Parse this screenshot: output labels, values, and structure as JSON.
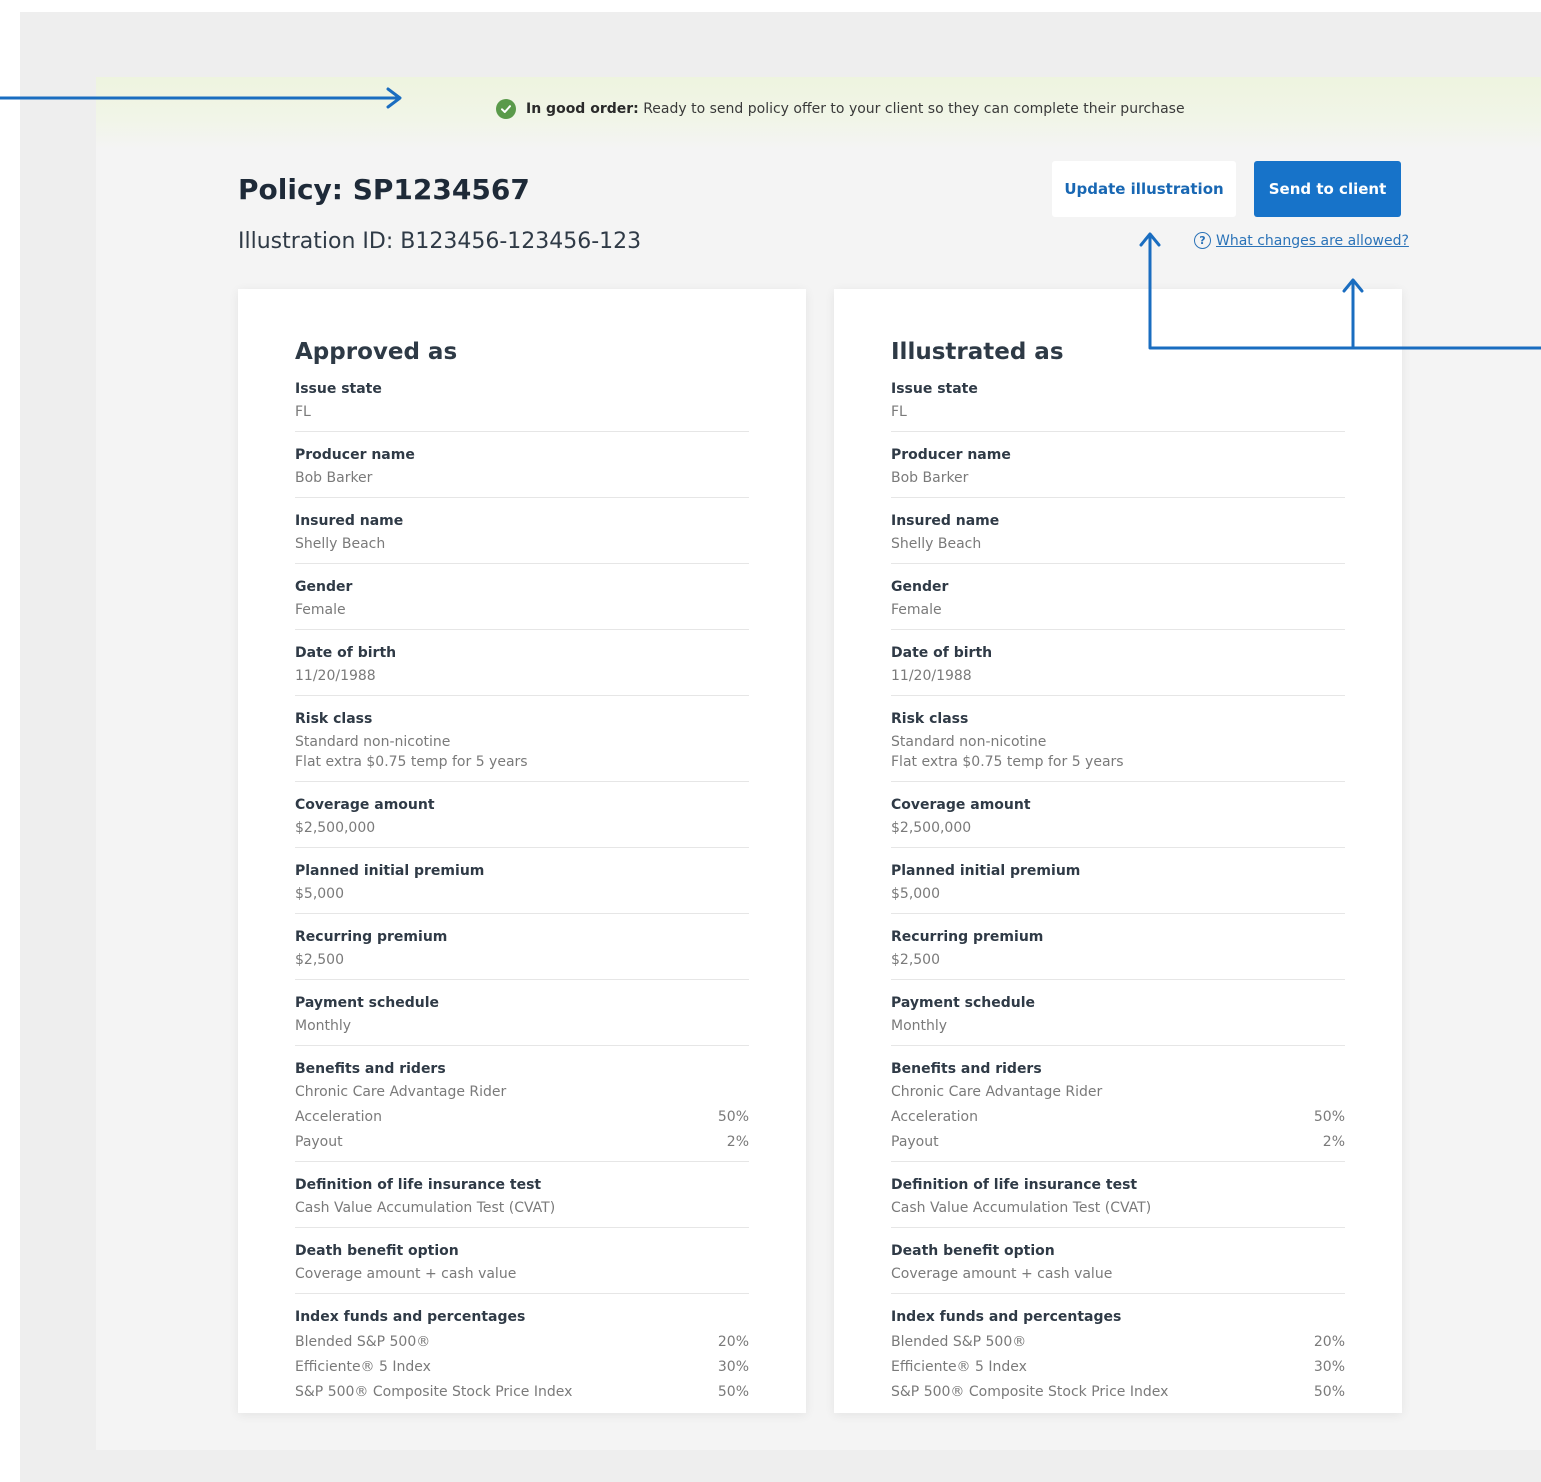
{
  "banner": {
    "status_label": "In good order:",
    "message": "Ready to send policy offer to your client so they can complete their purchase"
  },
  "header": {
    "policy_title": "Policy: SP1234567",
    "illustration_id": "Illustration ID: B123456-123456-123",
    "update_button": "Update illustration",
    "send_button": "Send to client",
    "help_link": "What changes are allowed?"
  },
  "colors": {
    "primary": "#1773c9",
    "success": "#5a9a4a",
    "annotation": "#1a6dc0"
  },
  "icons": [
    "check-circle-icon",
    "question-circle-icon",
    "annotation-arrow"
  ],
  "cards": {
    "approved": {
      "title": "Approved as",
      "issue_state": {
        "label": "Issue state",
        "value": "FL"
      },
      "producer_name": {
        "label": "Producer name",
        "value": "Bob Barker"
      },
      "insured_name": {
        "label": "Insured name",
        "value": "Shelly Beach"
      },
      "gender": {
        "label": "Gender",
        "value": "Female"
      },
      "date_of_birth": {
        "label": "Date of birth",
        "value": "11/20/1988"
      },
      "risk_class": {
        "label": "Risk class",
        "value": "Standard non-nicotine",
        "value2": "Flat extra $0.75 temp for 5 years"
      },
      "coverage_amount": {
        "label": "Coverage amount",
        "value": "$2,500,000"
      },
      "planned_initial_premium": {
        "label": "Planned initial premium",
        "value": "$5,000"
      },
      "recurring_premium": {
        "label": "Recurring premium",
        "value": "$2,500"
      },
      "payment_schedule": {
        "label": "Payment schedule",
        "value": "Monthly"
      },
      "benefits": {
        "label": "Benefits and riders",
        "rider": "Chronic Care Advantage Rider",
        "acceleration_label": "Acceleration",
        "acceleration_value": "50%",
        "payout_label": "Payout",
        "payout_value": "2%"
      },
      "life_test": {
        "label": "Definition of life insurance test",
        "value": "Cash Value Accumulation Test (CVAT)"
      },
      "death_benefit": {
        "label": "Death benefit option",
        "value": "Coverage amount + cash value"
      },
      "index_funds": {
        "label": "Index funds and percentages",
        "f1_name": "Blended S&P 500®",
        "f1_pct": "20%",
        "f2_name": "Efficiente® 5 Index",
        "f2_pct": "30%",
        "f3_name": "S&P 500® Composite Stock Price Index",
        "f3_pct": "50%"
      }
    },
    "illustrated": {
      "title": "Illustrated as",
      "issue_state": {
        "label": "Issue state",
        "value": "FL"
      },
      "producer_name": {
        "label": "Producer name",
        "value": "Bob Barker"
      },
      "insured_name": {
        "label": "Insured name",
        "value": "Shelly Beach"
      },
      "gender": {
        "label": "Gender",
        "value": "Female"
      },
      "date_of_birth": {
        "label": "Date of birth",
        "value": "11/20/1988"
      },
      "risk_class": {
        "label": "Risk class",
        "value": "Standard non-nicotine",
        "value2": "Flat extra $0.75 temp for 5 years"
      },
      "coverage_amount": {
        "label": "Coverage amount",
        "value": "$2,500,000"
      },
      "planned_initial_premium": {
        "label": "Planned initial premium",
        "value": "$5,000"
      },
      "recurring_premium": {
        "label": "Recurring premium",
        "value": "$2,500"
      },
      "payment_schedule": {
        "label": "Payment schedule",
        "value": "Monthly"
      },
      "benefits": {
        "label": "Benefits and riders",
        "rider": "Chronic Care Advantage Rider",
        "acceleration_label": "Acceleration",
        "acceleration_value": "50%",
        "payout_label": "Payout",
        "payout_value": "2%"
      },
      "life_test": {
        "label": "Definition of life insurance test",
        "value": "Cash Value Accumulation Test (CVAT)"
      },
      "death_benefit": {
        "label": "Death benefit option",
        "value": "Coverage amount + cash value"
      },
      "index_funds": {
        "label": "Index funds and percentages",
        "f1_name": "Blended S&P 500®",
        "f1_pct": "20%",
        "f2_name": "Efficiente® 5 Index",
        "f2_pct": "30%",
        "f3_name": "S&P 500® Composite Stock Price Index",
        "f3_pct": "50%"
      }
    }
  }
}
